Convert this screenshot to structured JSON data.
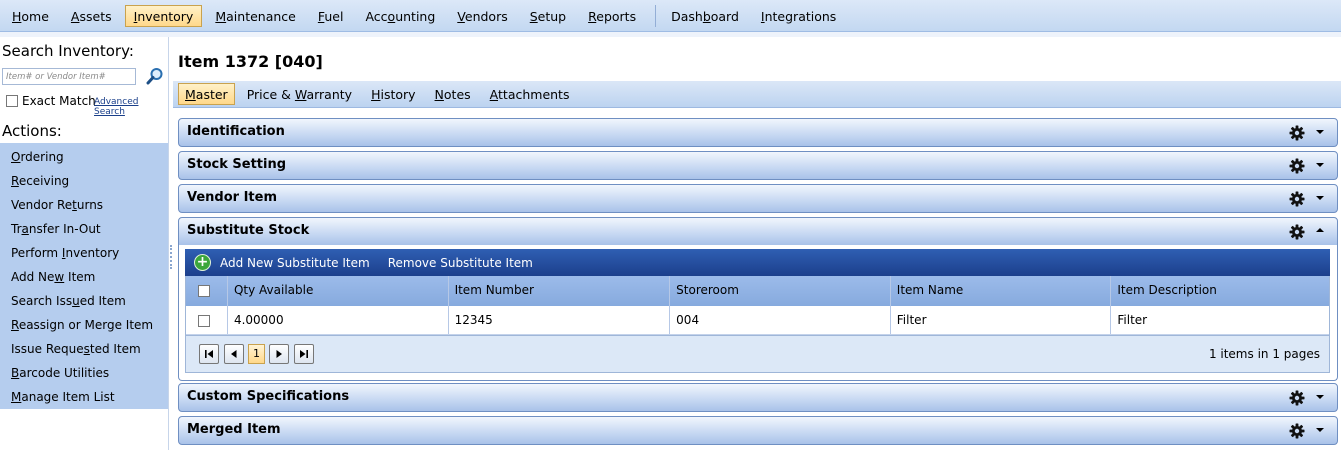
{
  "topnav": {
    "items": [
      {
        "pre": "",
        "u": "H",
        "post": "ome"
      },
      {
        "pre": "",
        "u": "A",
        "post": "ssets"
      },
      {
        "pre": "",
        "u": "I",
        "post": "nventory"
      },
      {
        "pre": "",
        "u": "M",
        "post": "aintenance"
      },
      {
        "pre": "",
        "u": "F",
        "post": "uel"
      },
      {
        "pre": "Acc",
        "u": "o",
        "post": "unting"
      },
      {
        "pre": "",
        "u": "V",
        "post": "endors"
      },
      {
        "pre": "",
        "u": "S",
        "post": "etup"
      },
      {
        "pre": "",
        "u": "R",
        "post": "eports"
      },
      {
        "pre": "Dash",
        "u": "b",
        "post": "oard"
      },
      {
        "pre": "",
        "u": "I",
        "post": "ntegrations"
      }
    ]
  },
  "search": {
    "title": "Search Inventory:",
    "placeholder": "Item# or Vendor Item#",
    "exact_match": "Exact Match",
    "advanced": "Advanced Search"
  },
  "actions": {
    "title": "Actions:",
    "items": [
      {
        "pre": "",
        "u": "O",
        "post": "rdering"
      },
      {
        "pre": "",
        "u": "R",
        "post": "eceiving"
      },
      {
        "pre": "Vendor Re",
        "u": "t",
        "post": "urns"
      },
      {
        "pre": "Tr",
        "u": "a",
        "post": "nsfer In-Out"
      },
      {
        "pre": "Perform ",
        "u": "I",
        "post": "nventory"
      },
      {
        "pre": "Add Ne",
        "u": "w",
        "post": " Item"
      },
      {
        "pre": "Search Iss",
        "u": "u",
        "post": "ed Item"
      },
      {
        "pre": "",
        "u": "R",
        "post": "eassign or Merge Item"
      },
      {
        "pre": "Issue Reque",
        "u": "s",
        "post": "ted Item"
      },
      {
        "pre": "",
        "u": "B",
        "post": "arcode Utilities"
      },
      {
        "pre": "",
        "u": "M",
        "post": "anage Item List"
      }
    ]
  },
  "item": {
    "title": "Item 1372 [040]"
  },
  "tabs": [
    {
      "pre": "",
      "u": "M",
      "post": "aster"
    },
    {
      "pre": "Price & ",
      "u": "W",
      "post": "arranty"
    },
    {
      "pre": "",
      "u": "H",
      "post": "istory"
    },
    {
      "pre": "",
      "u": "N",
      "post": "otes"
    },
    {
      "pre": "",
      "u": "A",
      "post": "ttachments"
    }
  ],
  "sections": {
    "identification": "Identification",
    "stock_setting": "Stock Setting",
    "vendor_item": "Vendor Item",
    "substitute_stock": "Substitute Stock",
    "custom_specifications": "Custom Specifications",
    "merged_item": "Merged Item"
  },
  "substitute": {
    "add_label": "Add New Substitute Item",
    "remove_label": "Remove Substitute Item",
    "columns": [
      "Qty Available",
      "Item Number",
      "Storeroom",
      "Item Name",
      "Item Description"
    ],
    "rows": [
      [
        "4.00000",
        "12345",
        "004",
        "Filter",
        "Filter"
      ]
    ],
    "pager": {
      "current_page": "1",
      "info": "1 items in 1 pages"
    }
  },
  "colors": {
    "accent_active": "#ffd88a",
    "toolbar_blue": "#1c3f8c",
    "actions_bg": "#b5cdee"
  },
  "icons": {
    "search": "magnifier-icon",
    "gear": "gear-icon",
    "add": "plus-circle-icon"
  }
}
